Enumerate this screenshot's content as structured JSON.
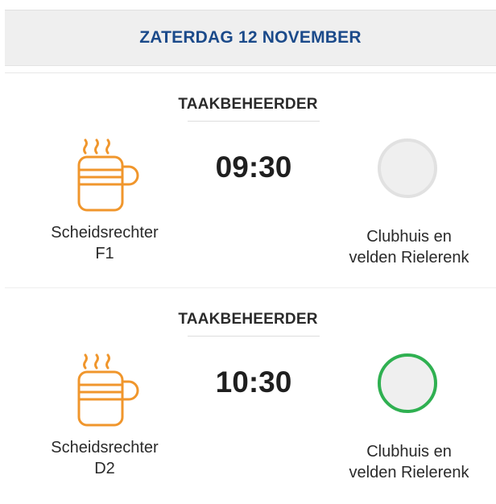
{
  "date_header": "ZATERDAG 12 NOVEMBER",
  "tasks": [
    {
      "role": "TAAKBEHEERDER",
      "icon": "coffee-cup-icon",
      "time": "09:30",
      "person_line1": "Scheidsrechter",
      "person_line2": "F1",
      "location_line1": "Clubhuis en",
      "location_line2": "velden Rielerenk",
      "status": "grey"
    },
    {
      "role": "TAAKBEHEERDER",
      "icon": "coffee-cup-icon",
      "time": "10:30",
      "person_line1": "Scheidsrechter",
      "person_line2": "D2",
      "location_line1": "Clubhuis en",
      "location_line2": "velden Rielerenk",
      "status": "green"
    }
  ],
  "colors": {
    "header_text": "#1b4a8a",
    "icon_orange": "#f0962c",
    "status_green": "#2fb051",
    "status_grey": "#e1e1e1"
  }
}
